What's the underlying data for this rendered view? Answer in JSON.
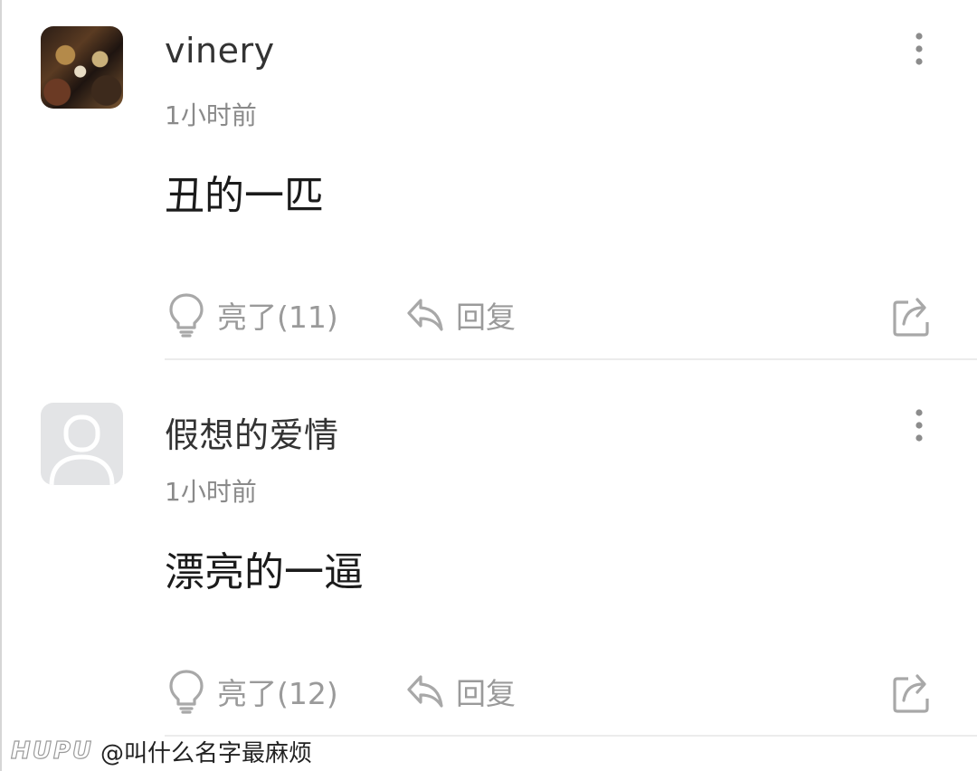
{
  "comments": [
    {
      "username": "vinery",
      "time": "1小时前",
      "content": "丑的一匹",
      "light_label": "亮了(11)",
      "reply_label": "回复",
      "avatar": "photo-avatar"
    },
    {
      "username": "假想的爱情",
      "time": "1小时前",
      "content": "漂亮的一逼",
      "light_label": "亮了(12)",
      "reply_label": "回复",
      "avatar": "default-avatar"
    }
  ],
  "icons": {
    "more": "more-vertical-icon",
    "light": "lightbulb-icon",
    "reply": "reply-arrow-icon",
    "share": "share-icon"
  },
  "watermark": {
    "logo": "HUPU",
    "handle": "@叫什么名字最麻烦"
  },
  "colors": {
    "icon_gray": "#a8a8a8",
    "text_gray": "#8a8a8a",
    "divider": "#ececec",
    "avatar_placeholder": "#e3e4e6"
  }
}
